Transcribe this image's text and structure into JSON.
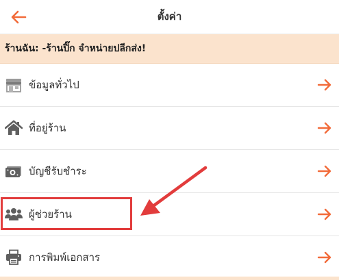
{
  "header": {
    "title": "ตั้งค่า",
    "back_icon": "arrow-left-icon"
  },
  "shop_banner": {
    "text": "ร้านฉัน: -ร้านปิ๊ก จำหน่ายปลีกส่ง!"
  },
  "menu": {
    "items": [
      {
        "label": "ข้อมูลทั่วไป",
        "icon": "store-icon"
      },
      {
        "label": "ที่อยู่ร้าน",
        "icon": "home-icon"
      },
      {
        "label": "บัญชีรับชำระ",
        "icon": "money-icon"
      },
      {
        "label": "ผู้ช่วยร้าน",
        "icon": "users-icon"
      },
      {
        "label": "การพิมพ์เอกสาร",
        "icon": "printer-icon"
      }
    ]
  },
  "colors": {
    "accent": "#f26b3a",
    "banner_bg": "#fbe3cd",
    "annotation": "#e23c3c",
    "icon_gray": "#5f5f5f"
  }
}
